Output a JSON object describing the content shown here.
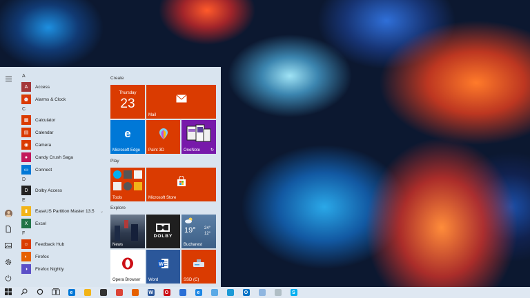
{
  "colors": {
    "tile_orange": "#da3b01",
    "tile_blue": "#0078d7",
    "tile_dark": "#2b3b4f",
    "menu_bg": "#e0ebf6",
    "taskbar_bg": "#dfe8f2"
  },
  "rail": {
    "icons": [
      "hamburger-icon",
      "user-avatar",
      "document-icon",
      "pictures-icon",
      "settings-icon",
      "power-icon"
    ]
  },
  "applist": {
    "sections": [
      {
        "letter": "A",
        "apps": [
          {
            "label": "Access",
            "color": "#a4373a",
            "icon": "A"
          },
          {
            "label": "Alarms & Clock",
            "color": "#da3b01",
            "icon": "⏰"
          }
        ]
      },
      {
        "letter": "C",
        "apps": [
          {
            "label": "Calculator",
            "color": "#da3b01",
            "icon": "▦"
          },
          {
            "label": "Calendar",
            "color": "#da3b01",
            "icon": "▤"
          },
          {
            "label": "Camera",
            "color": "#da3b01",
            "icon": "◉"
          },
          {
            "label": "Candy Crush Saga",
            "color": "#c2185b",
            "icon": "●"
          },
          {
            "label": "Connect",
            "color": "#0078d7",
            "icon": "▭"
          }
        ]
      },
      {
        "letter": "D",
        "apps": [
          {
            "label": "Dolby Access",
            "color": "#222222",
            "icon": "D"
          }
        ]
      },
      {
        "letter": "E",
        "apps": [
          {
            "label": "EaseUS Partition Master 13.5",
            "color": "#f2b418",
            "icon": "▮",
            "expandable": true
          },
          {
            "label": "Excel",
            "color": "#217346",
            "icon": "X"
          }
        ]
      },
      {
        "letter": "F",
        "apps": [
          {
            "label": "Feedback Hub",
            "color": "#da3b01",
            "icon": "☺"
          },
          {
            "label": "Firefox",
            "color": "#e66000",
            "icon": "◐"
          },
          {
            "label": "Firefox Nightly",
            "color": "#5b4fc7",
            "icon": "◑"
          }
        ]
      }
    ]
  },
  "tiles": {
    "groups": [
      "Create",
      "Play",
      "Explore"
    ],
    "calendar": {
      "day": "Thursday",
      "date": "23"
    },
    "mail": "Mail",
    "edge": "Microsoft Edge",
    "paint3d": "Paint 3D",
    "onenote": "OneNote",
    "tools": "Tools",
    "store": "Microsoft Store",
    "news": "News",
    "dolby": "DOLBY",
    "weather": {
      "temp": "19°",
      "high": "24°",
      "low": "12°",
      "city": "Bucharest"
    },
    "opera": "Opera Browser",
    "word": "Word",
    "ssd": "SSD (C)"
  },
  "taskbar": {
    "items": [
      {
        "name": "start-button",
        "icon": "windows-logo"
      },
      {
        "name": "search-button",
        "icon": "search-icon"
      },
      {
        "name": "cortana-button",
        "icon": "cortana-icon"
      },
      {
        "name": "taskview-button",
        "icon": "taskview-icon"
      },
      {
        "name": "taskbar-edge",
        "icon": "edge-icon",
        "color": "#0078d7",
        "glyph": "e"
      },
      {
        "name": "taskbar-explorer",
        "icon": "folder-icon",
        "color": "#f2b418",
        "glyph": ""
      },
      {
        "name": "taskbar-store",
        "icon": "store-icon",
        "color": "#333333",
        "glyph": ""
      },
      {
        "name": "taskbar-chrome",
        "icon": "chrome-icon",
        "color": "#db4437",
        "glyph": ""
      },
      {
        "name": "taskbar-firefox",
        "icon": "firefox-icon",
        "color": "#e66000",
        "glyph": ""
      },
      {
        "name": "taskbar-word",
        "icon": "word-icon",
        "color": "#2b579a",
        "glyph": "W"
      },
      {
        "name": "taskbar-opera",
        "icon": "opera-icon",
        "color": "#cc0f16",
        "glyph": "O"
      },
      {
        "name": "taskbar-onedrive",
        "icon": "cloud-icon",
        "color": "#2a6fd6",
        "glyph": ""
      },
      {
        "name": "taskbar-ie",
        "icon": "ie-icon",
        "color": "#1e88e5",
        "glyph": "e"
      },
      {
        "name": "taskbar-notepad",
        "icon": "notepad-icon",
        "color": "#5aa9e6",
        "glyph": ""
      },
      {
        "name": "taskbar-edge-beta",
        "icon": "edge-beta-icon",
        "color": "#1b9ad6",
        "glyph": ""
      },
      {
        "name": "taskbar-outlook",
        "icon": "outlook-icon",
        "color": "#0072c6",
        "glyph": "O"
      },
      {
        "name": "taskbar-app1",
        "icon": "app-icon",
        "color": "#8fb6e0",
        "glyph": ""
      },
      {
        "name": "taskbar-app2",
        "icon": "app-icon",
        "color": "#b0bec5",
        "glyph": ""
      },
      {
        "name": "taskbar-skype",
        "icon": "skype-icon",
        "color": "#00aff0",
        "glyph": "S"
      }
    ]
  }
}
